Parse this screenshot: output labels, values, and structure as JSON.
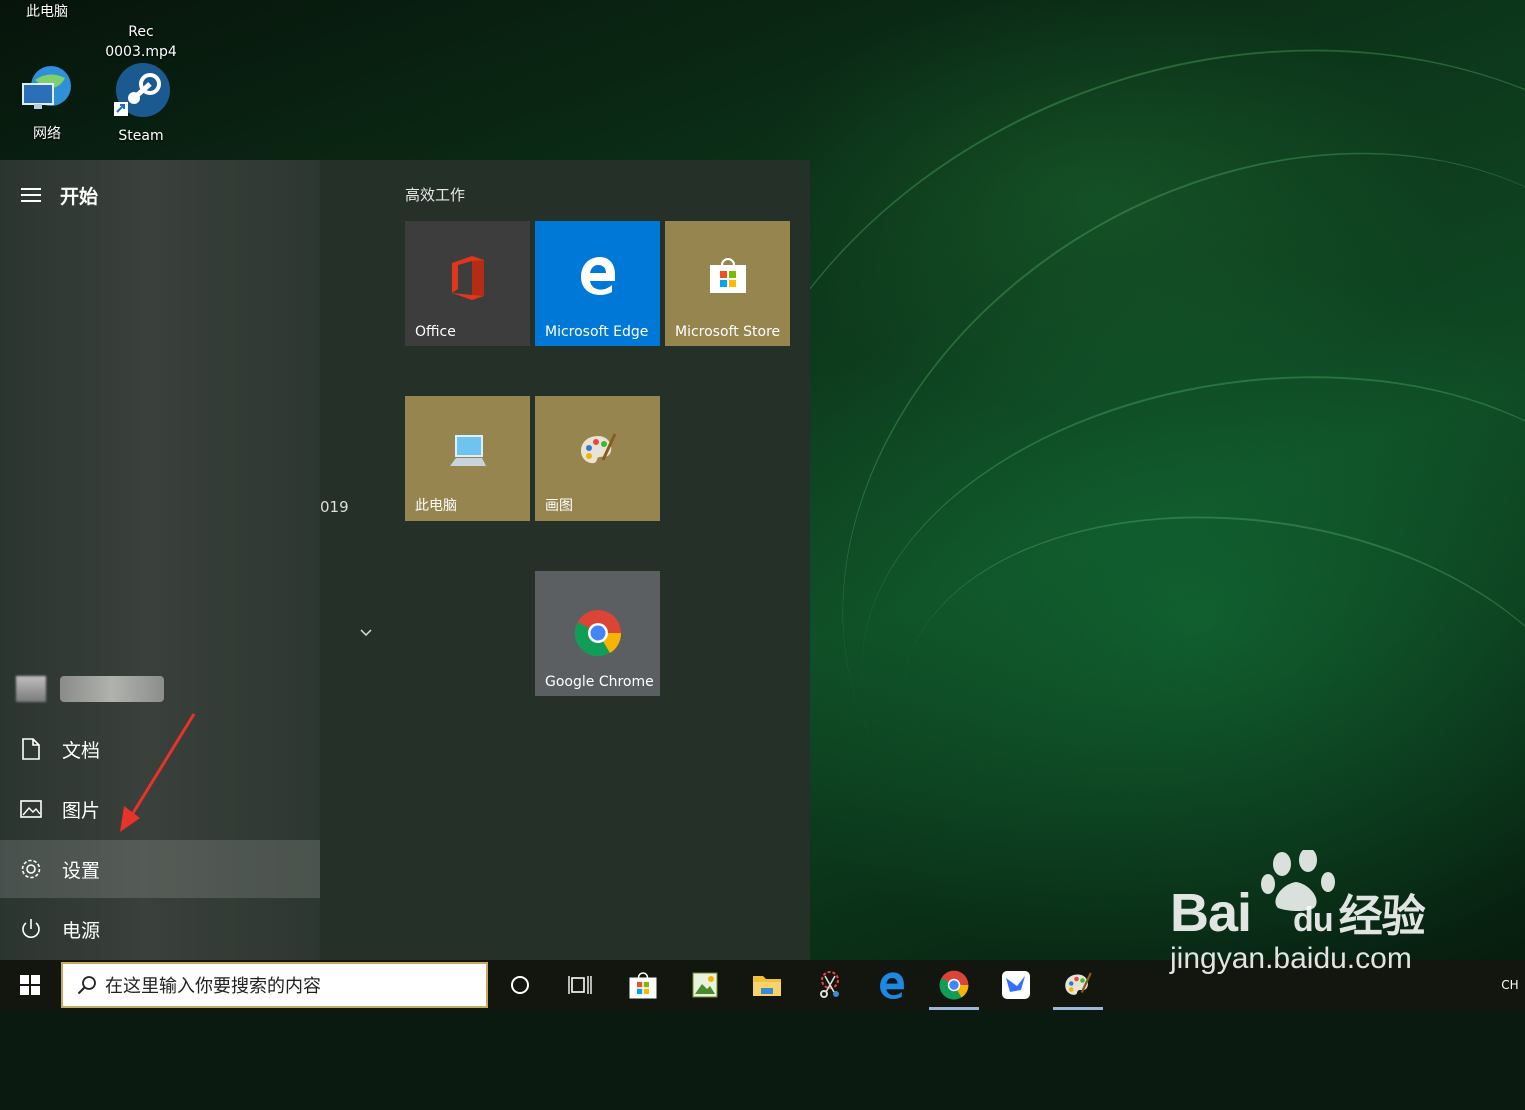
{
  "desktop": {
    "icons": [
      {
        "label": "此电脑"
      },
      {
        "label": "Rec\n0003.mp4"
      },
      {
        "label": "网络"
      },
      {
        "label": "Steam"
      }
    ]
  },
  "start_menu": {
    "title": "开始",
    "user_name": "",
    "nav": [
      {
        "label": "文档",
        "icon": "document-icon"
      },
      {
        "label": "图片",
        "icon": "pictures-icon"
      },
      {
        "label": "设置",
        "icon": "gear-icon"
      },
      {
        "label": "电源",
        "icon": "power-icon"
      }
    ],
    "partial_text": "019",
    "group_title": "高效工作",
    "tiles": [
      {
        "label": "Office",
        "color": "#3d3d3d"
      },
      {
        "label": "Microsoft Edge",
        "color": "#0078d7"
      },
      {
        "label": "Microsoft Store",
        "color": "#978550"
      },
      {
        "label": "此电脑",
        "color": "#978550"
      },
      {
        "label": "画图",
        "color": "#978550"
      },
      {
        "label": "Google Chrome",
        "color": "#5c5f62"
      }
    ]
  },
  "taskbar": {
    "search_placeholder": "在这里输入你要搜索的内容",
    "tray_text": "CH"
  },
  "watermark": {
    "brand": "Bai",
    "brand2": "du",
    "suffix": "经验",
    "url": "jingyan.baidu.com"
  }
}
